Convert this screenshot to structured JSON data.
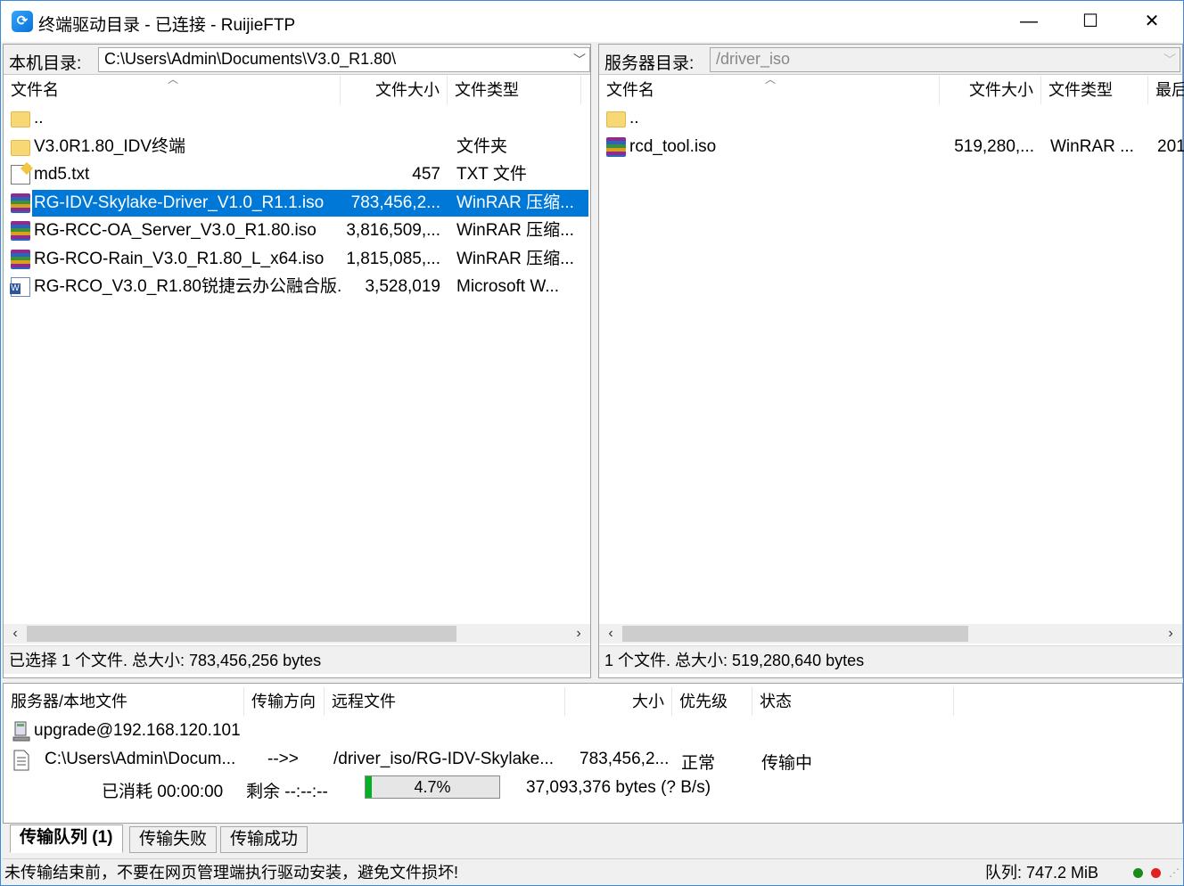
{
  "window": {
    "title": "终端驱动目录 - 已连接 - RuijieFTP",
    "min_icon": "minimize-icon",
    "max_icon": "maximize-icon",
    "close_icon": "close-icon"
  },
  "local": {
    "label": "本机目录:",
    "path": "C:\\Users\\Admin\\Documents\\V3.0_R1.80\\",
    "columns": {
      "name": "文件名",
      "size": "文件大小",
      "type": "文件类型"
    },
    "files": [
      {
        "name": "..",
        "size": "",
        "type": "",
        "icon": "folder-icon"
      },
      {
        "name": "V3.0R1.80_IDV终端",
        "size": "",
        "type": "文件夹",
        "icon": "folder-icon"
      },
      {
        "name": "md5.txt",
        "size": "457",
        "type": "TXT 文件",
        "icon": "text-file-icon"
      },
      {
        "name": "RG-IDV-Skylake-Driver_V1.0_R1.1.iso",
        "size": "783,456,2...",
        "type": "WinRAR 压缩...",
        "icon": "winrar-icon",
        "selected": true
      },
      {
        "name": "RG-RCC-OA_Server_V3.0_R1.80.iso",
        "size": "3,816,509,...",
        "type": "WinRAR 压缩...",
        "icon": "winrar-icon"
      },
      {
        "name": "RG-RCO-Rain_V3.0_R1.80_L_x64.iso",
        "size": "1,815,085,...",
        "type": "WinRAR 压缩...",
        "icon": "winrar-icon"
      },
      {
        "name": "RG-RCO_V3.0_R1.80锐捷云办公融合版...",
        "size": "3,528,019",
        "type": "Microsoft W...",
        "icon": "word-doc-icon"
      }
    ],
    "status": "已选择 1 个文件. 总大小: 783,456,256 bytes"
  },
  "remote": {
    "label": "服务器目录:",
    "path": "/driver_iso",
    "columns": {
      "name": "文件名",
      "size": "文件大小",
      "type": "文件类型",
      "modified": "最后"
    },
    "files": [
      {
        "name": "..",
        "size": "",
        "type": "",
        "modified": "",
        "icon": "folder-icon"
      },
      {
        "name": "rcd_tool.iso",
        "size": "519,280,...",
        "type": "WinRAR ...",
        "modified": "201",
        "icon": "winrar-icon"
      }
    ],
    "status": "1 个文件. 总大小: 519,280,640 bytes"
  },
  "queue": {
    "columns": {
      "local": "服务器/本地文件",
      "direction": "传输方向",
      "remote": "远程文件",
      "size": "大小",
      "priority": "优先级",
      "status": "状态"
    },
    "server": "upgrade@192.168.120.101",
    "item": {
      "local": "C:\\Users\\Admin\\Docum...",
      "direction": "-->>",
      "remote": "/driver_iso/RG-IDV-Skylake...",
      "size": "783,456,2...",
      "priority": "正常",
      "status": "传输中"
    },
    "elapsed": "已消耗 00:00:00",
    "remaining": "剩余 --:--:--",
    "progress_percent": 4.7,
    "progress_label": "4.7%",
    "transferred": "37,093,376 bytes (? B/s)"
  },
  "tabs": [
    "传输队列 (1)",
    "传输失败",
    "传输成功"
  ],
  "statusbar": {
    "message": "未传输结束前，不要在网页管理端执行驱动安装，避免文件损坏!",
    "queue": "队列: 747.2 MiB",
    "led_green": "#1a8a1a",
    "led_red": "#e02020"
  }
}
